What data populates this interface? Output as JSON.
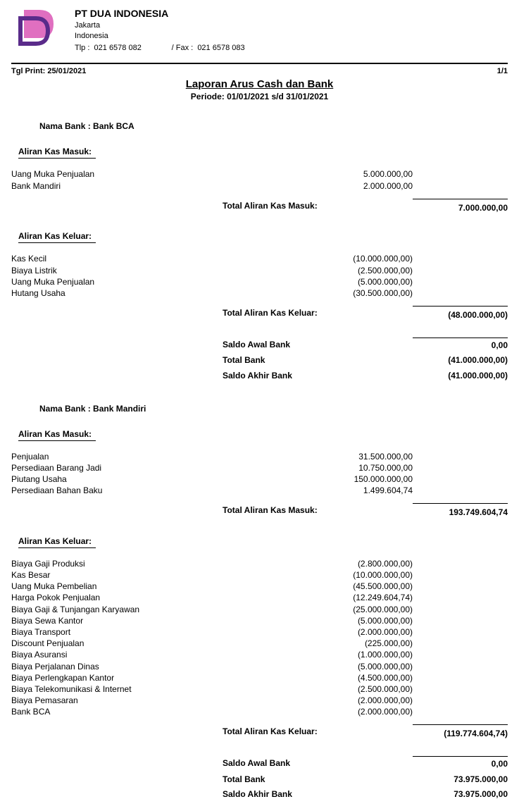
{
  "company": {
    "name": "PT DUA INDONESIA",
    "city": "Jakarta",
    "country": "Indonesia",
    "tel_label": "Tlp :",
    "tel": "021 6578 082",
    "fax_label": "/ Fax :",
    "fax": "021 6578 083"
  },
  "meta": {
    "print_label": "Tgl Print: 25/01/2021",
    "page": "1/1"
  },
  "report": {
    "title": "Laporan Arus Cash dan Bank",
    "period": "Periode: 01/01/2021 s/d 31/01/2021"
  },
  "labels": {
    "bank_prefix": "Nama Bank :",
    "inflow": "Aliran Kas Masuk:",
    "outflow": "Aliran Kas Keluar:",
    "total_in": "Total Aliran Kas Masuk:",
    "total_out": "Total Aliran Kas Keluar:",
    "begin": "Saldo Awal Bank",
    "total_bank": "Total Bank",
    "end": "Saldo Akhir Bank"
  },
  "banks": [
    {
      "name": "Bank BCA",
      "inflows": [
        {
          "label": "Uang Muka Penjualan",
          "amount": "5.000.000,00"
        },
        {
          "label": "Bank Mandiri",
          "amount": "2.000.000,00"
        }
      ],
      "total_in": "7.000.000,00",
      "outflows": [
        {
          "label": "Kas Kecil",
          "amount": "(10.000.000,00)"
        },
        {
          "label": "Biaya Listrik",
          "amount": "(2.500.000,00)"
        },
        {
          "label": "Uang Muka Penjualan",
          "amount": "(5.000.000,00)"
        },
        {
          "label": "Hutang Usaha",
          "amount": "(30.500.000,00)"
        }
      ],
      "total_out": "(48.000.000,00)",
      "begin": "0,00",
      "total_bank": "(41.000.000,00)",
      "end": "(41.000.000,00)"
    },
    {
      "name": "Bank Mandiri",
      "inflows": [
        {
          "label": "Penjualan",
          "amount": "31.500.000,00"
        },
        {
          "label": "Persediaan Barang Jadi",
          "amount": "10.750.000,00"
        },
        {
          "label": "Piutang Usaha",
          "amount": "150.000.000,00"
        },
        {
          "label": "Persediaan Bahan Baku",
          "amount": "1.499.604,74"
        }
      ],
      "total_in": "193.749.604,74",
      "outflows": [
        {
          "label": "Biaya Gaji Produksi",
          "amount": "(2.800.000,00)"
        },
        {
          "label": "Kas Besar",
          "amount": "(10.000.000,00)"
        },
        {
          "label": "Uang Muka Pembelian",
          "amount": "(45.500.000,00)"
        },
        {
          "label": "Harga Pokok Penjualan",
          "amount": "(12.249.604,74)"
        },
        {
          "label": "Biaya Gaji & Tunjangan Karyawan",
          "amount": "(25.000.000,00)"
        },
        {
          "label": "Biaya Sewa Kantor",
          "amount": "(5.000.000,00)"
        },
        {
          "label": "Biaya Transport",
          "amount": "(2.000.000,00)"
        },
        {
          "label": "Discount Penjualan",
          "amount": "(225.000,00)"
        },
        {
          "label": "Biaya Asuransi",
          "amount": "(1.000.000,00)"
        },
        {
          "label": "Biaya Perjalanan Dinas",
          "amount": "(5.000.000,00)"
        },
        {
          "label": "Biaya Perlengkapan Kantor",
          "amount": "(4.500.000,00)"
        },
        {
          "label": "Biaya Telekomunikasi & Internet",
          "amount": "(2.500.000,00)"
        },
        {
          "label": "Biaya Pemasaran",
          "amount": "(2.000.000,00)"
        },
        {
          "label": "Bank BCA",
          "amount": "(2.000.000,00)"
        }
      ],
      "total_out": "(119.774.604,74)",
      "begin": "0,00",
      "total_bank": "73.975.000,00",
      "end": "73.975.000,00"
    }
  ]
}
